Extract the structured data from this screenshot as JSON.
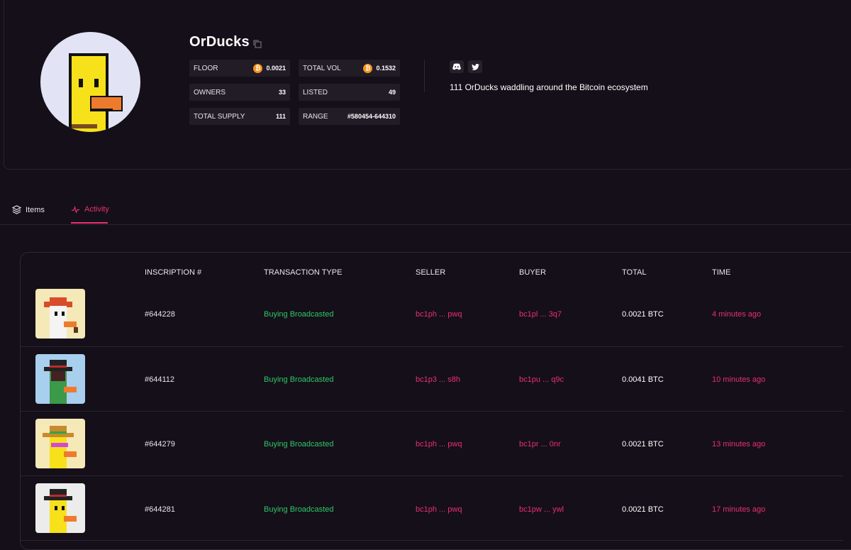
{
  "collection": {
    "name": "OrDucks",
    "description": "111 OrDucks waddling around the Bitcoin ecosystem"
  },
  "stats": {
    "floor": {
      "label": "FLOOR",
      "value": "0.0021"
    },
    "total_vol": {
      "label": "TOTAL VOL",
      "value": "0.1532"
    },
    "owners": {
      "label": "OWNERS",
      "value": "33"
    },
    "listed": {
      "label": "LISTED",
      "value": "49"
    },
    "total_supply": {
      "label": "TOTAL SUPPLY",
      "value": "111"
    },
    "range": {
      "label": "RANGE",
      "value": "#580454-644310"
    }
  },
  "tabs": {
    "items": "Items",
    "activity": "Activity"
  },
  "table": {
    "headers": [
      "INSCRIPTION #",
      "TRANSACTION TYPE",
      "SELLER",
      "BUYER",
      "TOTAL",
      "TIME"
    ],
    "rows": [
      {
        "inscription": "#644228",
        "type": "Buying Broadcasted",
        "seller": "bc1ph ... pwq",
        "buyer": "bc1pl ... 3q7",
        "total": "0.0021 BTC",
        "time": "4 minutes ago"
      },
      {
        "inscription": "#644112",
        "type": "Buying Broadcasted",
        "seller": "bc1p3 ... s8h",
        "buyer": "bc1pu ... q9c",
        "total": "0.0041 BTC",
        "time": "10 minutes ago"
      },
      {
        "inscription": "#644279",
        "type": "Buying Broadcasted",
        "seller": "bc1ph ... pwq",
        "buyer": "bc1pr ... 0nr",
        "total": "0.0021 BTC",
        "time": "13 minutes ago"
      },
      {
        "inscription": "#644281",
        "type": "Buying Broadcasted",
        "seller": "bc1ph ... pwq",
        "buyer": "bc1pw ... ywl",
        "total": "0.0021 BTC",
        "time": "17 minutes ago"
      }
    ]
  },
  "colors": {
    "background": "#150f19",
    "accent": "#e8306f",
    "success": "#2ec866",
    "bitcoin": "#f7931a"
  },
  "icons": {
    "copy": "copy-icon",
    "discord": "discord-icon",
    "twitter": "twitter-icon",
    "bitcoin": "bitcoin-icon",
    "layers": "layers-icon",
    "activity": "activity-pulse-icon"
  }
}
